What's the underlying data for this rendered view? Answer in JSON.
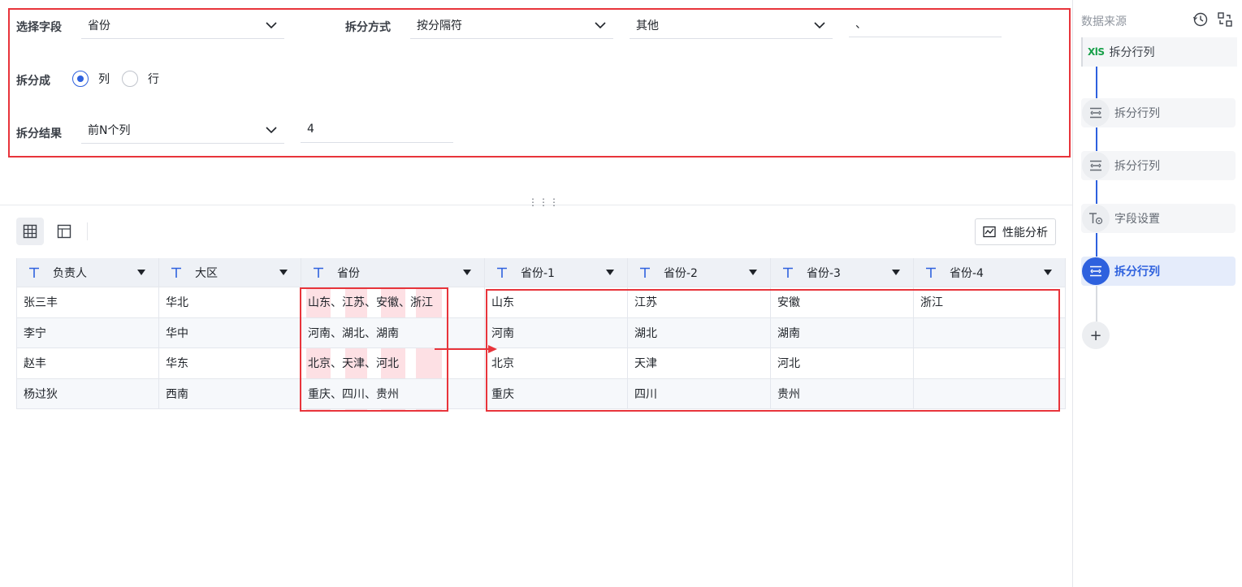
{
  "config": {
    "select_field_label": "选择字段",
    "select_field_value": "省份",
    "split_method_label": "拆分方式",
    "split_method_value": "按分隔符",
    "delimiter_type_value": "其他",
    "delimiter_value": "、",
    "split_into_label": "拆分成",
    "split_into_options": [
      "列",
      "行"
    ],
    "split_into_selected": "列",
    "split_result_label": "拆分结果",
    "split_result_value": "前N个列",
    "split_count_value": "4"
  },
  "toolbar": {
    "performance_label": "性能分析",
    "icons": [
      "grid-view-icon",
      "layout-view-icon",
      "performance-chart-icon"
    ]
  },
  "table": {
    "headers": [
      "负责人",
      "大区",
      "省份",
      "省份-1",
      "省份-2",
      "省份-3",
      "省份-4"
    ],
    "rows": [
      [
        "张三丰",
        "华北",
        "山东、江苏、安徽、浙江",
        "山东",
        "江苏",
        "安徽",
        "浙江"
      ],
      [
        "李宁",
        "华中",
        "河南、湖北、湖南",
        "河南",
        "湖北",
        "湖南",
        ""
      ],
      [
        "赵丰",
        "华东",
        "北京、天津、河北",
        "北京",
        "天津",
        "河北",
        ""
      ],
      [
        "杨过狄",
        "西南",
        "重庆、四川、贵州",
        "重庆",
        "四川",
        "贵州",
        ""
      ]
    ]
  },
  "side": {
    "title": "数据来源",
    "source_badge": "XlS",
    "source_item": "拆分行列",
    "steps": [
      {
        "label": "拆分行列",
        "icon": "split-icon",
        "active": false
      },
      {
        "label": "拆分行列",
        "icon": "split-icon",
        "active": false
      },
      {
        "label": "字段设置",
        "icon": "field-settings-icon",
        "active": false
      },
      {
        "label": "拆分行列",
        "icon": "split-icon",
        "active": true
      }
    ],
    "add_label": "+",
    "colors": {
      "accent": "#2e61de",
      "highlight_border": "#e8343b",
      "highlight_fill": "#fde0e4"
    }
  }
}
